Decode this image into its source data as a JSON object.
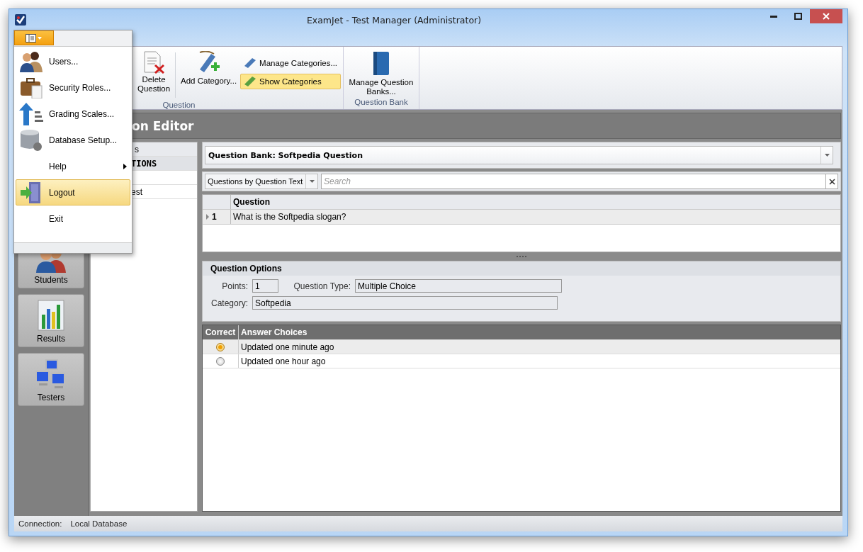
{
  "window": {
    "title": "ExamJet - Test Manager (Administrator)"
  },
  "app_menu": {
    "items": [
      {
        "kind": "users",
        "label": "Users...",
        "selected": false
      },
      {
        "kind": "roles",
        "label": "Security Roles...",
        "selected": false
      },
      {
        "kind": "grading",
        "label": "Grading Scales...",
        "selected": false
      },
      {
        "kind": "database",
        "label": "Database Setup...",
        "selected": false
      },
      {
        "kind": "submenu",
        "label": "Help",
        "selected": false
      },
      {
        "kind": "logout",
        "label": "Logout",
        "selected": true
      },
      {
        "kind": "plain",
        "label": "Exit",
        "selected": false
      }
    ]
  },
  "ribbon": {
    "groups": [
      {
        "label": "Question",
        "buttons": [
          {
            "kind": "delete",
            "lines": [
              "Delete",
              "Question"
            ]
          },
          {
            "kind": "separator"
          },
          {
            "kind": "add-category",
            "lines": [
              "Add Category..."
            ]
          },
          {
            "kind": "small-stack",
            "items": [
              {
                "label": "Manage Categories...",
                "selected": false
              },
              {
                "label": "Show Categories",
                "selected": true
              }
            ]
          }
        ]
      },
      {
        "label": "Question Bank",
        "buttons": [
          {
            "kind": "book",
            "lines": [
              "Manage Question",
              "Banks..."
            ]
          }
        ]
      }
    ]
  },
  "nav": {
    "buttons": [
      {
        "kind": "students",
        "label": "Students"
      },
      {
        "kind": "results",
        "label": "Results"
      },
      {
        "kind": "testers",
        "label": "Testers"
      }
    ]
  },
  "editor": {
    "title": "on Editor",
    "list": {
      "header": "s",
      "category": "TIONS",
      "items": [
        {
          "kind": "covered"
        },
        {
          "kind": "text",
          "text": "est"
        }
      ]
    },
    "question_bank": "Question Bank: Softpedia Question",
    "filter": {
      "mode": "Questions by Question Text",
      "search": {
        "placeholder": "Search"
      }
    },
    "questions": {
      "columns": [
        "Question"
      ],
      "rows": [
        {
          "number": "1",
          "text": "What is the Softpedia slogan?",
          "selected": true
        }
      ]
    },
    "options": {
      "title": "Question Options",
      "fields": [
        {
          "label": "Points:",
          "value": "1"
        },
        {
          "label": "Question Type:",
          "value": "Multiple Choice"
        },
        {
          "label": "Category:",
          "value": "Softpedia"
        }
      ]
    },
    "answers": {
      "columns": [
        "Correct",
        "Answer Choices"
      ],
      "rows": [
        {
          "correct": true,
          "text": "Updated one minute ago",
          "selected": true
        },
        {
          "correct": false,
          "text": "Updated one hour ago",
          "selected": false
        }
      ]
    }
  },
  "status_bar": {
    "label": "Connection:",
    "value": "Local Database"
  }
}
